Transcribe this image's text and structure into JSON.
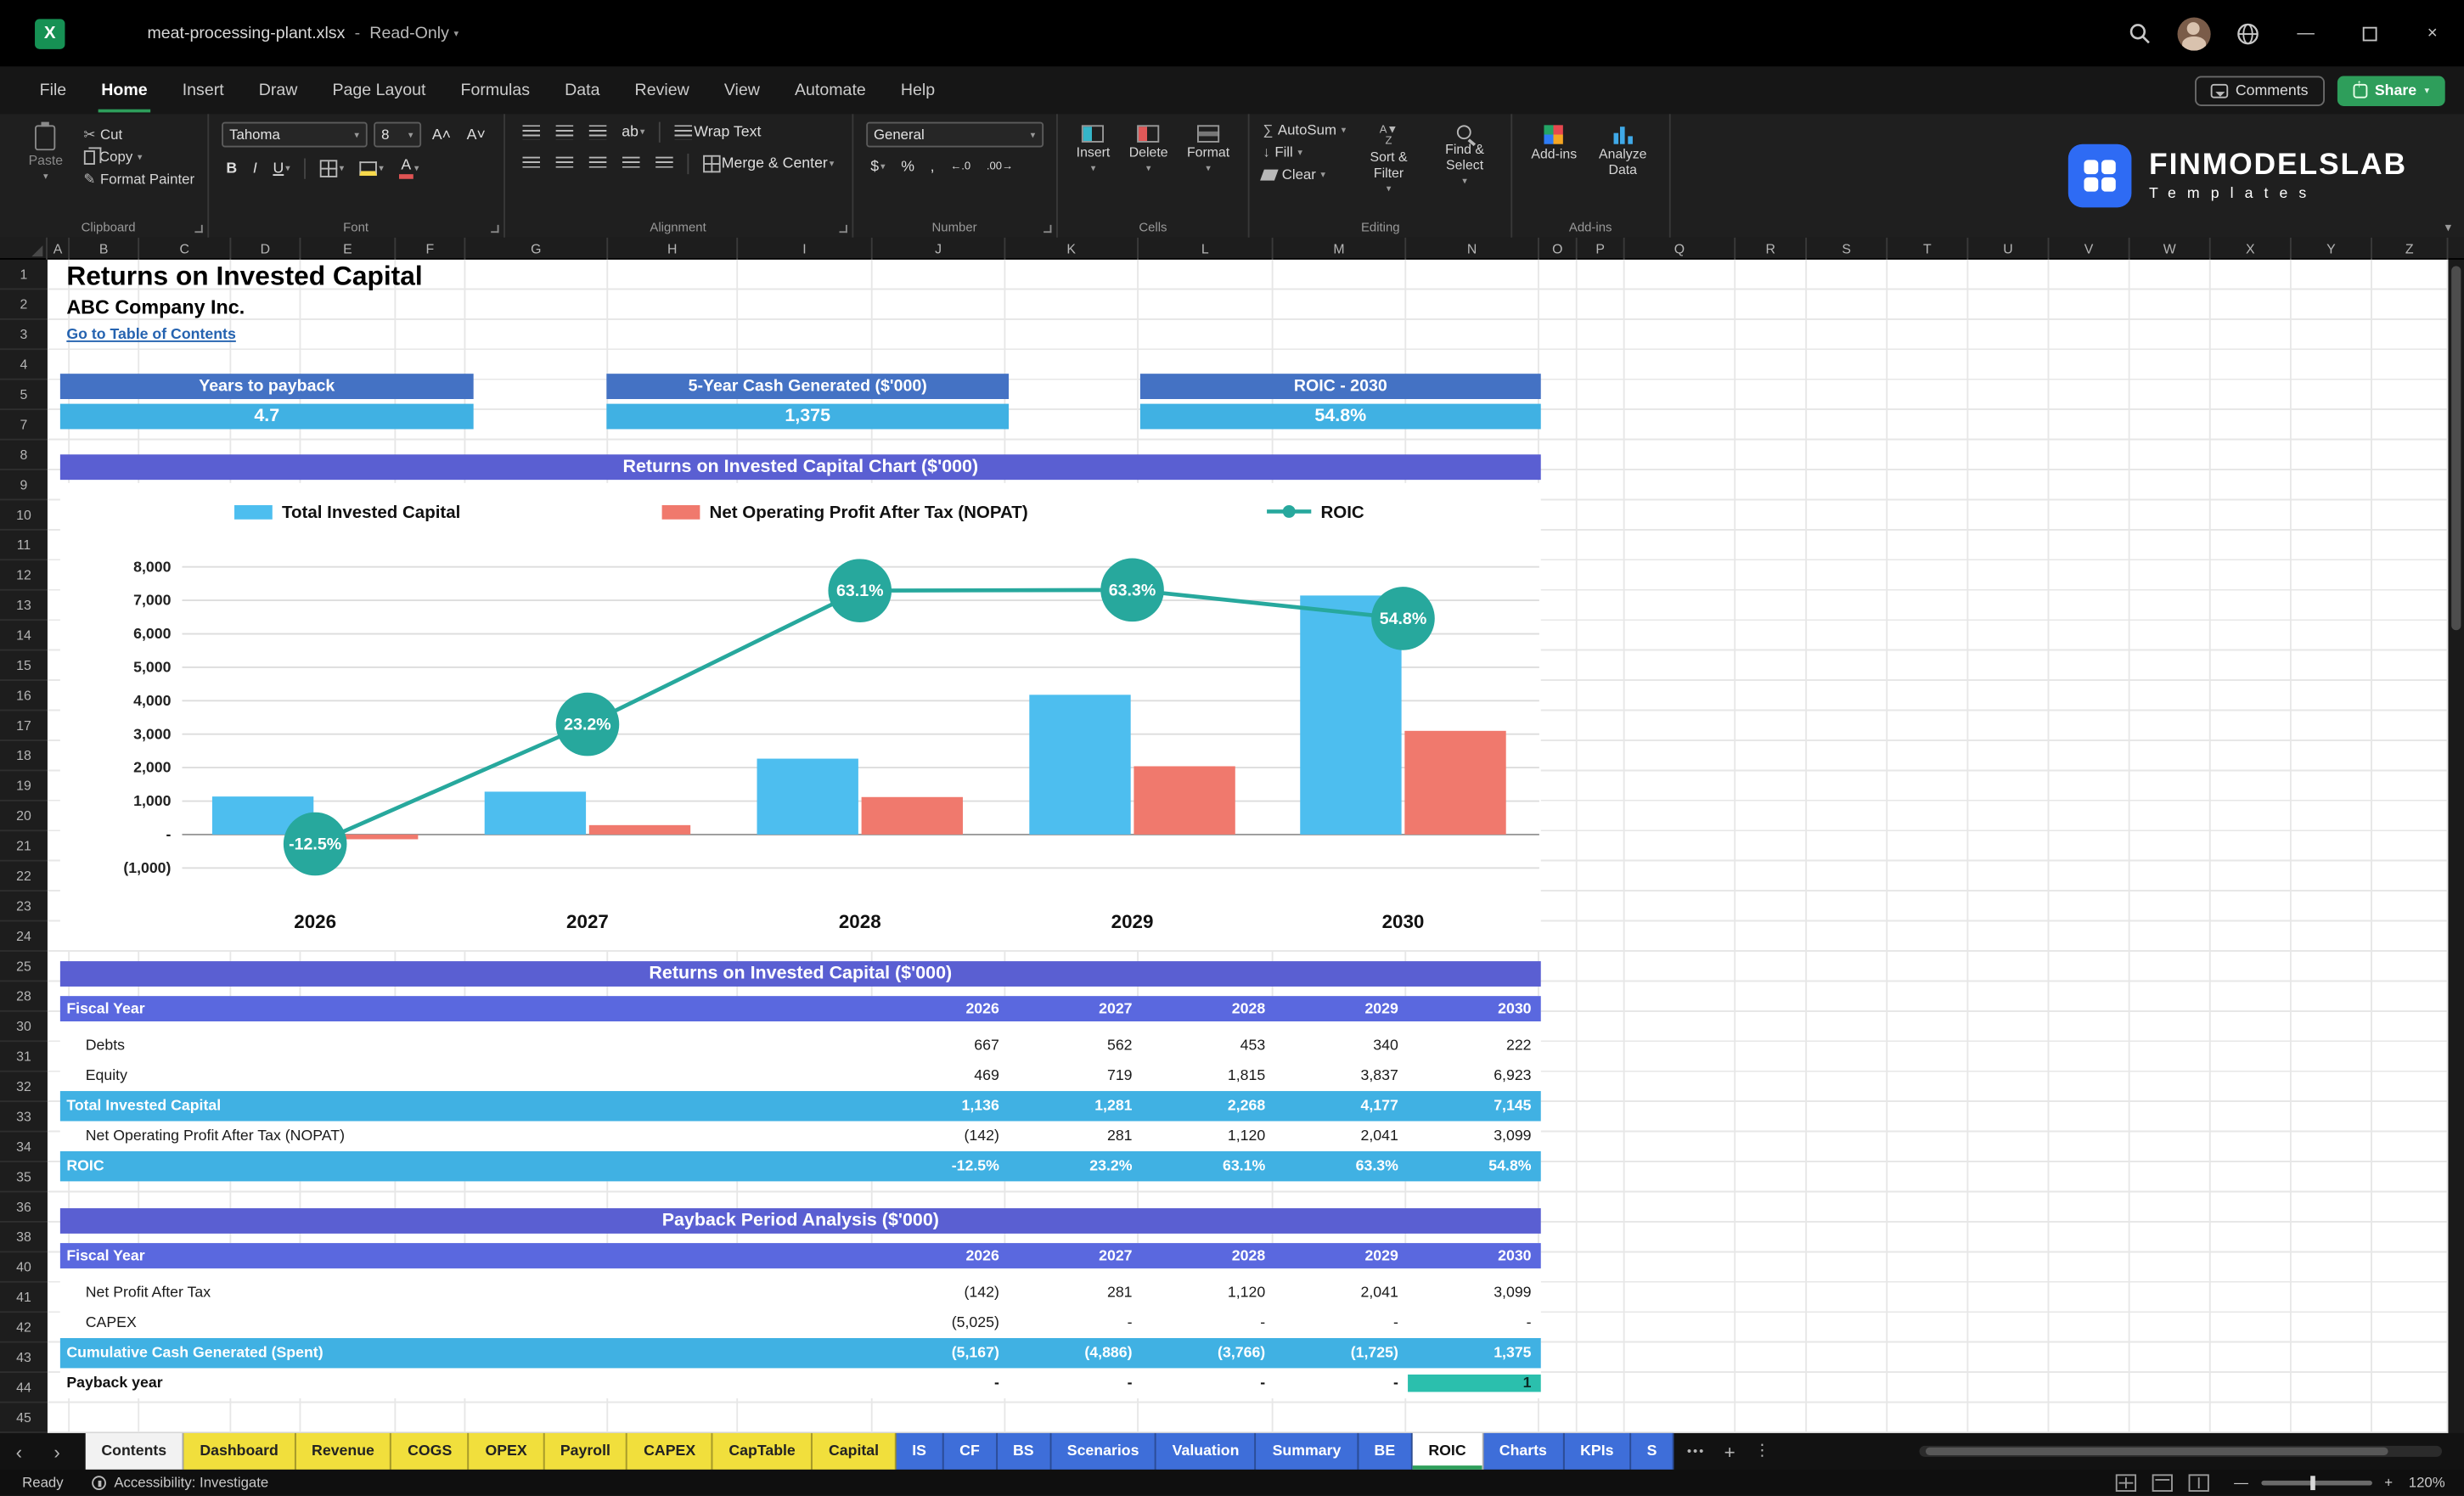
{
  "colors": {
    "accent_green": "#2E9E5B",
    "banner_purple": "#5A5FD2",
    "table_header_blue": "#5A68DF",
    "kpi_header_blue": "#4472C4",
    "cyan_highlight": "#40B1E3",
    "bar_blue": "#4DBEEF",
    "bar_salmon": "#F0796D",
    "line_teal": "#27A89D",
    "payback_teal": "#2BBFAD",
    "tab_yellow": "#F1DF3C",
    "tab_blue": "#3E6ED9",
    "link_blue": "#2563B0"
  },
  "titlebar": {
    "file": "meat-processing-plant.xlsx",
    "separator": "-",
    "mode": "Read-Only"
  },
  "menubar": {
    "items": [
      "File",
      "Home",
      "Insert",
      "Draw",
      "Page Layout",
      "Formulas",
      "Data",
      "Review",
      "View",
      "Automate",
      "Help"
    ],
    "active": "Home",
    "comments": "Comments",
    "share": "Share"
  },
  "ribbon": {
    "clipboard": {
      "label": "Clipboard",
      "paste": "Paste",
      "cut": "Cut",
      "copy": "Copy",
      "format_painter": "Format Painter"
    },
    "font": {
      "label": "Font",
      "name": "Tahoma",
      "size": "8",
      "bold": "B",
      "italic": "I",
      "underline": "U"
    },
    "alignment": {
      "label": "Alignment",
      "wrap_text": "Wrap Text",
      "merge_center": "Merge & Center"
    },
    "number": {
      "label": "Number",
      "format": "General"
    },
    "cells": {
      "label": "Cells",
      "insert": "Insert",
      "delete": "Delete",
      "format": "Format"
    },
    "editing": {
      "label": "Editing",
      "autosum": "AutoSum",
      "fill": "Fill",
      "clear": "Clear",
      "sort_filter": "Sort & Filter",
      "find_select": "Find & Select"
    },
    "addins_group": {
      "label": "Add-ins",
      "addins": "Add-ins",
      "analyze_data": "Analyze Data"
    },
    "brand": {
      "name": "FINMODELSLAB",
      "sub": "Templates"
    }
  },
  "grid": {
    "columns": [
      "A",
      "B",
      "C",
      "D",
      "E",
      "F",
      "G",
      "H",
      "I",
      "J",
      "K",
      "L",
      "M",
      "N",
      "O",
      "P",
      "Q",
      "R",
      "S",
      "T",
      "U",
      "V",
      "W",
      "X",
      "Y",
      "Z"
    ],
    "rows": [
      "1",
      "2",
      "3",
      "4",
      "5",
      "7",
      "8",
      "9",
      "10",
      "11",
      "12",
      "13",
      "14",
      "15",
      "16",
      "17",
      "18",
      "19",
      "20",
      "21",
      "22",
      "23",
      "24",
      "25",
      "28",
      "30",
      "31",
      "32",
      "33",
      "34",
      "35",
      "36",
      "38",
      "40",
      "41",
      "42",
      "43",
      "44",
      "45"
    ]
  },
  "sheet": {
    "title": "Returns on Invested Capital",
    "subtitle": "ABC Company Inc.",
    "toc_link": "Go to Table of Contents",
    "kpis": [
      {
        "label": "Years to payback",
        "value": "4.7"
      },
      {
        "label": "5-Year Cash Generated ($'000)",
        "value": "1,375"
      },
      {
        "label": "ROIC - 2030",
        "value": "54.8%"
      }
    ]
  },
  "chart_data": {
    "type": "bar",
    "title": "Returns on Invested Capital Chart ($'000)",
    "categories": [
      "2026",
      "2027",
      "2028",
      "2029",
      "2030"
    ],
    "series": [
      {
        "name": "Total Invested Capital",
        "type": "bar",
        "values": [
          1136,
          1281,
          2268,
          4177,
          7145
        ]
      },
      {
        "name": "Net Operating Profit After Tax (NOPAT)",
        "type": "bar",
        "values": [
          -142,
          281,
          1120,
          2041,
          3099
        ]
      },
      {
        "name": "ROIC",
        "type": "line",
        "axis": "percent",
        "values": [
          -12.5,
          23.2,
          63.1,
          63.3,
          54.8
        ],
        "point_labels": [
          "-12.5%",
          "23.2%",
          "63.1%",
          "63.3%",
          "54.8%"
        ]
      }
    ],
    "y_axis": {
      "min": -1000,
      "max": 8000,
      "step": 1000,
      "tick_labels": [
        "8,000",
        "7,000",
        "6,000",
        "5,000",
        "4,000",
        "3,000",
        "2,000",
        "1,000",
        "-",
        "(1,000)"
      ]
    },
    "legend_position": "top",
    "grid": true
  },
  "tables": [
    {
      "banner": "Returns on Invested Capital ($'000)",
      "columns": [
        "Fiscal Year",
        "2026",
        "2027",
        "2028",
        "2029",
        "2030"
      ],
      "rows": [
        {
          "label": "Debts",
          "values": [
            "667",
            "562",
            "453",
            "340",
            "222"
          ],
          "style": "normal",
          "indent": true
        },
        {
          "label": "Equity",
          "values": [
            "469",
            "719",
            "1,815",
            "3,837",
            "6,923"
          ],
          "style": "normal",
          "indent": true
        },
        {
          "label": "Total Invested Capital",
          "values": [
            "1,136",
            "1,281",
            "2,268",
            "4,177",
            "7,145"
          ],
          "style": "highlight",
          "indent": false
        },
        {
          "label": "Net Operating Profit After Tax (NOPAT)",
          "values": [
            "(142)",
            "281",
            "1,120",
            "2,041",
            "3,099"
          ],
          "style": "normal",
          "indent": true
        },
        {
          "label": "ROIC",
          "values": [
            "-12.5%",
            "23.2%",
            "63.1%",
            "63.3%",
            "54.8%"
          ],
          "style": "highlight",
          "indent": false
        }
      ]
    },
    {
      "banner": "Payback Period Analysis ($'000)",
      "columns": [
        "Fiscal Year",
        "2026",
        "2027",
        "2028",
        "2029",
        "2030"
      ],
      "rows": [
        {
          "label": "Net Profit After Tax",
          "values": [
            "(142)",
            "281",
            "1,120",
            "2,041",
            "3,099"
          ],
          "style": "normal",
          "indent": true
        },
        {
          "label": "CAPEX",
          "values": [
            "(5,025)",
            "-",
            "-",
            "-",
            "-"
          ],
          "style": "normal",
          "indent": true
        },
        {
          "label": "Cumulative Cash Generated (Spent)",
          "values": [
            "(5,167)",
            "(4,886)",
            "(3,766)",
            "(1,725)",
            "1,375"
          ],
          "style": "highlight",
          "indent": false
        },
        {
          "label": "Payback year",
          "values": [
            "-",
            "-",
            "-",
            "-",
            "1"
          ],
          "style": "payback",
          "indent": false
        }
      ]
    }
  ],
  "sheet_tabs": {
    "items": [
      {
        "label": "Contents",
        "style": "light"
      },
      {
        "label": "Dashboard",
        "style": "yellow"
      },
      {
        "label": "Revenue",
        "style": "yellow"
      },
      {
        "label": "COGS",
        "style": "yellow"
      },
      {
        "label": "OPEX",
        "style": "yellow"
      },
      {
        "label": "Payroll",
        "style": "yellow"
      },
      {
        "label": "CAPEX",
        "style": "yellow"
      },
      {
        "label": "CapTable",
        "style": "yellow"
      },
      {
        "label": "Capital",
        "style": "yellow"
      },
      {
        "label": "IS",
        "style": "blue"
      },
      {
        "label": "CF",
        "style": "blue"
      },
      {
        "label": "BS",
        "style": "blue"
      },
      {
        "label": "Scenarios",
        "style": "blue"
      },
      {
        "label": "Valuation",
        "style": "blue"
      },
      {
        "label": "Summary",
        "style": "blue"
      },
      {
        "label": "BE",
        "style": "blue"
      },
      {
        "label": "ROIC",
        "style": "active"
      },
      {
        "label": "Charts",
        "style": "blue"
      },
      {
        "label": "KPIs",
        "style": "blue"
      },
      {
        "label": "S",
        "style": "blue"
      }
    ],
    "overflow": "•••"
  },
  "statusbar": {
    "ready": "Ready",
    "accessibility": "Accessibility: Investigate",
    "zoom": "120%"
  }
}
